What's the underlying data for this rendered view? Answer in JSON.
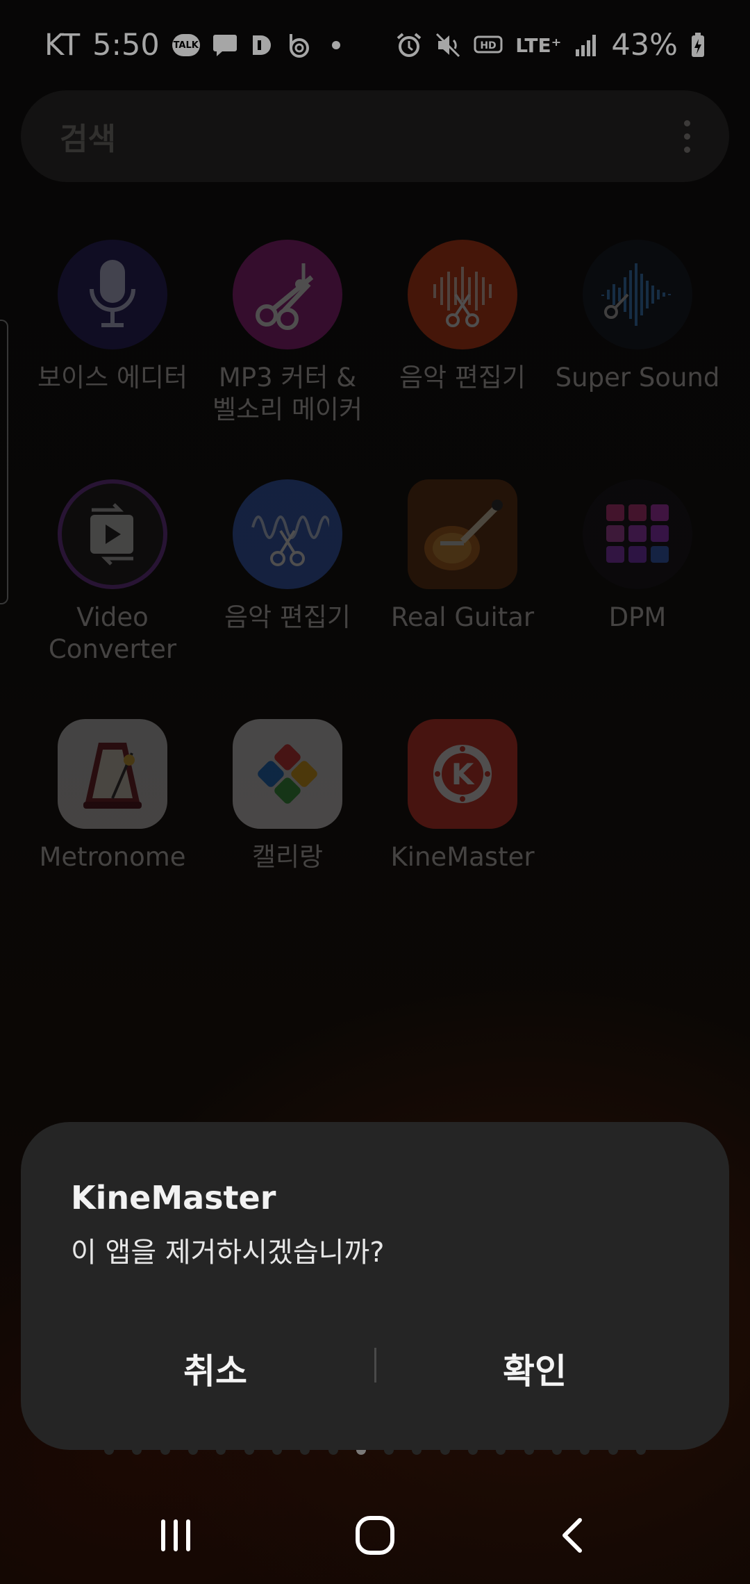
{
  "status_bar": {
    "carrier": "KT",
    "time": "5:50",
    "talk_badge": "TALK",
    "hd_badge": "HD",
    "network": "LTE⁺",
    "battery": "43%"
  },
  "search": {
    "placeholder": "검색"
  },
  "apps": [
    {
      "label": "보이스 에디터",
      "icon": "voice-editor-icon",
      "color": "#3a2f8f"
    },
    {
      "label": "MP3 커터 &\n벨소리 메이커",
      "icon": "mp3-cutter-icon",
      "color": "#b8279b"
    },
    {
      "label": "음악 편집기",
      "icon": "music-editor-icon",
      "color": "#ea4a18"
    },
    {
      "label": "Super Sound",
      "icon": "super-sound-icon",
      "color": "#1c2230"
    },
    {
      "label": "Video\nConverter",
      "icon": "video-converter-icon",
      "color": "#222222"
    },
    {
      "label": "음악 편집기",
      "icon": "music-editor-blue-icon",
      "color": "#3f6fd8"
    },
    {
      "label": "Real Guitar",
      "icon": "guitar-icon",
      "color": "#8a4a16"
    },
    {
      "label": "DPM",
      "icon": "drum-pads-icon",
      "color": "#1c1c24"
    },
    {
      "label": "Metronome",
      "icon": "metronome-icon",
      "color": "#d8d8d8"
    },
    {
      "label": "캘리랑",
      "icon": "calligraphy-icon",
      "color": "#e0e0e0"
    },
    {
      "label": "KineMaster",
      "icon": "kinemaster-icon",
      "color": "#ea3b2f"
    }
  ],
  "dialog": {
    "title": "KineMaster",
    "message": "이 앱을 제거하시겠습니까?",
    "cancel_label": "취소",
    "ok_label": "확인"
  },
  "page_indicator": {
    "total": 20,
    "active_index": 9
  },
  "navbar": {
    "recents": "recents-icon",
    "home": "home-icon",
    "back": "back-icon"
  }
}
